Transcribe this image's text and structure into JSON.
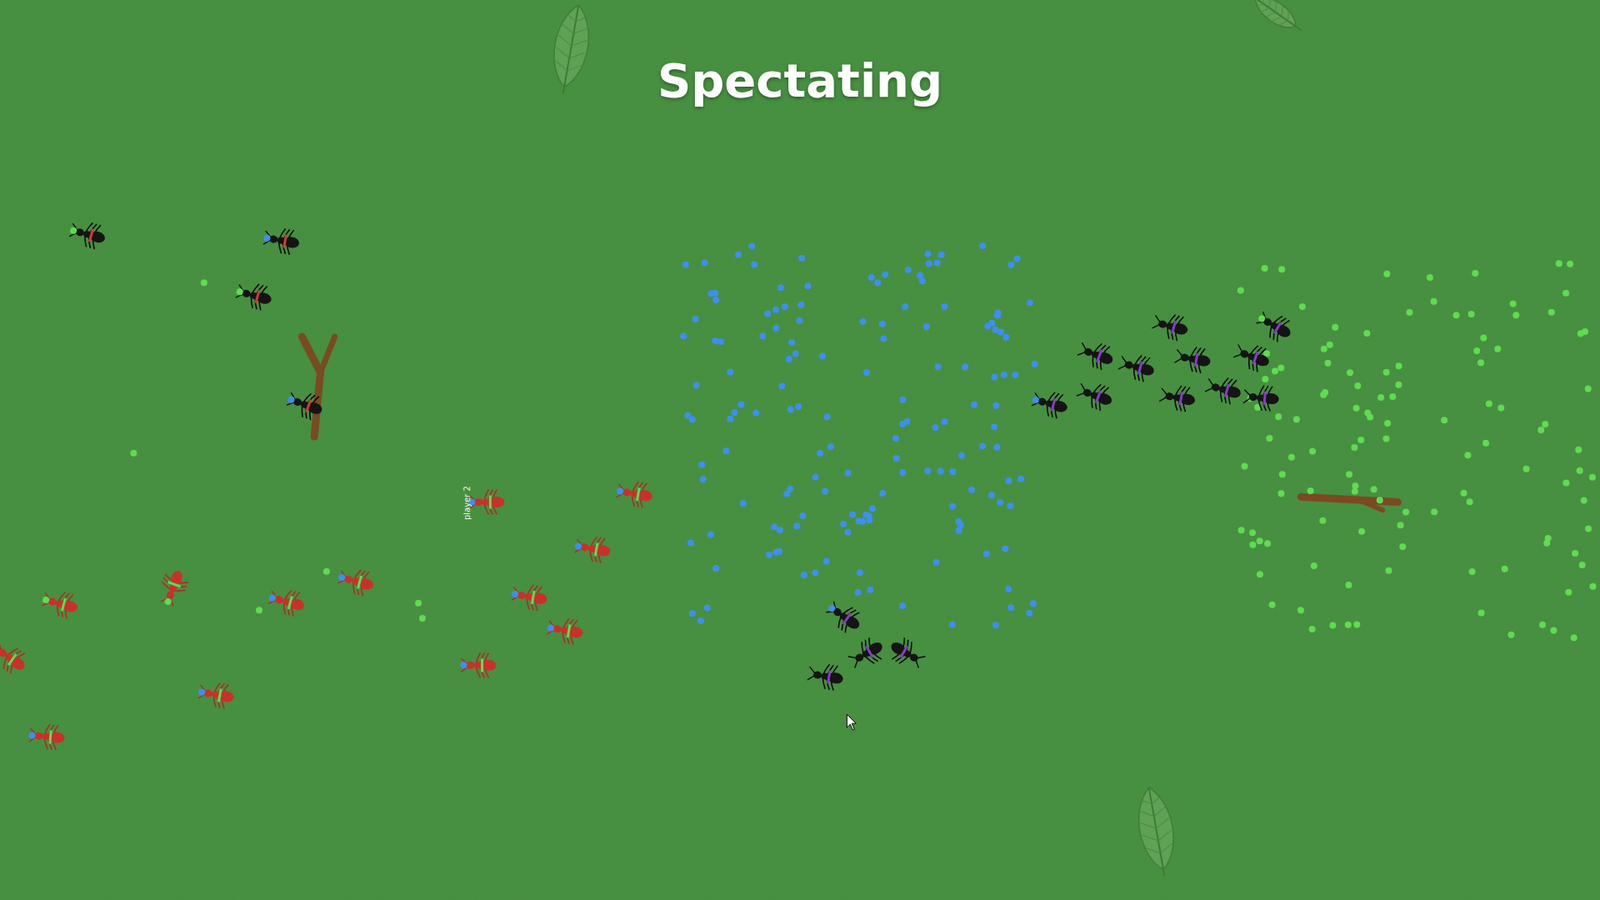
{
  "title": "Spectating",
  "player_label": "player 2",
  "food": [
    {
      "color": "#3d8ff0"
    },
    {
      "color": "#5fdc50"
    }
  ],
  "ants": [
    {
      "kind": "black",
      "color": "#d23a3a",
      "carrying": "#5fdc50"
    },
    {
      "kind": "black",
      "color": "#d23a3a",
      "carrying": "#3d8ff0"
    },
    {
      "kind": "black",
      "color": "#d23a3a",
      "carrying": "#5fdc50"
    },
    {
      "kind": "black",
      "color": "#d23a3a",
      "carrying": "#3d8ff0"
    },
    {
      "kind": "black",
      "color": "#8a3ac8",
      "carrying": null
    },
    {
      "kind": "black",
      "color": "#8a3ac8",
      "carrying": null
    },
    {
      "kind": "black",
      "color": "#8a3ac8",
      "carrying": null
    },
    {
      "kind": "black",
      "color": "#8a3ac8",
      "carrying": null
    },
    {
      "kind": "black",
      "color": "#8a3ac8",
      "carrying": "#3d8ff0"
    },
    {
      "kind": "black",
      "color": "#8a3ac8",
      "carrying": null
    },
    {
      "kind": "black",
      "color": "#8a3ac8",
      "carrying": null
    },
    {
      "kind": "black",
      "color": "#8a3ac8",
      "carrying": null
    },
    {
      "kind": "black",
      "color": "#8a3ac8",
      "carrying": null
    },
    {
      "kind": "black",
      "color": "#8a3ac8",
      "carrying": "#5fdc50"
    },
    {
      "kind": "black",
      "color": "#8a3ac8",
      "carrying": null
    },
    {
      "kind": "black",
      "color": "#8a3ac8",
      "carrying": "#3d8ff0"
    },
    {
      "kind": "black",
      "color": "#8a3ac8",
      "carrying": null
    },
    {
      "kind": "black",
      "color": "#8a3ac8",
      "carrying": null
    },
    {
      "kind": "black",
      "color": "#8a3ac8",
      "carrying": null
    },
    {
      "kind": "red",
      "color": "#5fdc50",
      "carrying": "#3d8ff0"
    },
    {
      "kind": "red",
      "color": "#5fdc50",
      "carrying": "#3d8ff0"
    },
    {
      "kind": "red",
      "color": "#5fdc50",
      "carrying": "#3d8ff0"
    },
    {
      "kind": "red",
      "color": "#5fdc50",
      "carrying": "#3d8ff0"
    },
    {
      "kind": "red",
      "color": "#5fdc50",
      "carrying": "#3d8ff0"
    },
    {
      "kind": "red",
      "color": "#5fdc50",
      "carrying": "#3d8ff0"
    },
    {
      "kind": "red",
      "color": "#5fdc50",
      "carrying": "#3d8ff0"
    },
    {
      "kind": "red",
      "color": "#5fdc50",
      "carrying": "#3d8ff0"
    },
    {
      "kind": "red",
      "color": "#5fdc50",
      "carrying": "#5fdc50"
    },
    {
      "kind": "red",
      "color": "#5fdc50",
      "carrying": "#5fdc50"
    },
    {
      "kind": "red",
      "color": "#5fdc50",
      "carrying": null
    },
    {
      "kind": "red",
      "color": "#5fdc50",
      "carrying": "#3d8ff0"
    },
    {
      "kind": "red",
      "color": "#5fdc50",
      "carrying": "#3d8ff0"
    }
  ]
}
